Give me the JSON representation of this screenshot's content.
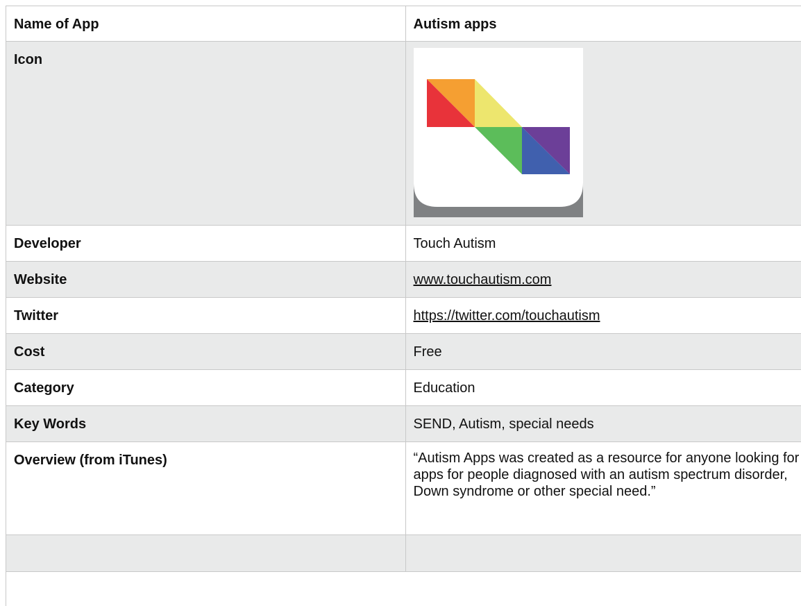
{
  "table": {
    "header": {
      "label": "Name of App",
      "value": "Autism apps"
    },
    "icon_row": {
      "label": "Icon",
      "icon_name": "autism-apps-app-icon"
    },
    "rows": [
      {
        "label": "Developer",
        "value": "Touch Autism"
      },
      {
        "label": "Website",
        "value": "www.touchautism.com"
      },
      {
        "label": "Twitter",
        "value": "https://twitter.com/touchautism"
      },
      {
        "label": "Cost",
        "value": "Free"
      },
      {
        "label": "Category",
        "value": "Education"
      },
      {
        "label": "Key Words",
        "value": "SEND, Autism, special needs"
      },
      {
        "label": "Overview (from iTunes)",
        "value": "“Autism Apps was created as a resource for anyone looking for apps for people diagnosed with an autism spectrum disorder, Down syndrome or other special need.”"
      }
    ]
  },
  "colors": {
    "row_alt": "#e9eaea",
    "border": "#c8c8c8",
    "icon_red": "#e8333a",
    "icon_orange": "#f59f32",
    "icon_yellow": "#ede66e",
    "icon_green": "#5cbd5a",
    "icon_blue": "#4060ae",
    "icon_purple": "#6c3f98",
    "icon_shadow": "#7f8183"
  }
}
